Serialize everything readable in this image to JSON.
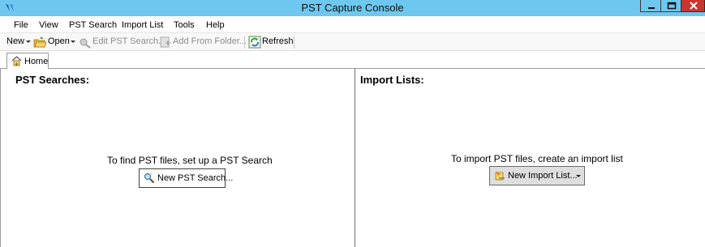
{
  "window": {
    "title": "PST Capture Console",
    "icon": "pst-capture-app-icon",
    "controls": [
      "minimize-icon",
      "maximize-icon",
      "close-icon"
    ]
  },
  "menu": {
    "items": [
      "File",
      "View",
      "PST Search",
      "Import List",
      "Tools",
      "Help"
    ]
  },
  "toolbar": {
    "new_label": "New",
    "open_label": "Open",
    "edit_label": "Edit PST Search...",
    "add_folder_label": "Add From Folder...",
    "refresh_label": "Refresh"
  },
  "tabs": [
    {
      "label": "Home",
      "icon": "home-icon",
      "selected": true
    }
  ],
  "left_pane": {
    "title": "PST Searches:",
    "hint": "To find PST files, set up a PST Search",
    "button_label": "New PST Search...",
    "button_icon": "search-icon"
  },
  "right_pane": {
    "title": "Import Lists:",
    "hint": "To import PST files, create an import list",
    "button_label": "New Import List...",
    "button_icon": "import-list-icon"
  },
  "colors": {
    "titlebar": "#6ec7ee",
    "close_button": "#c7372f"
  }
}
